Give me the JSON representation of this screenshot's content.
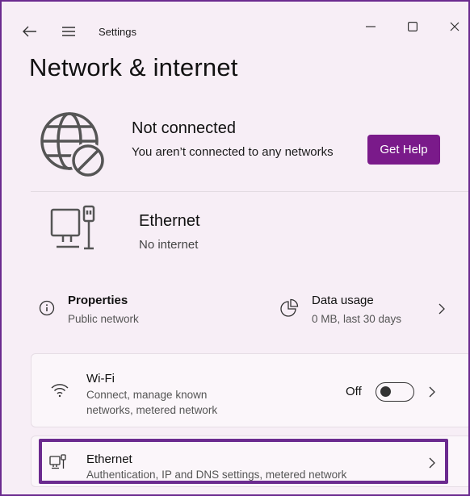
{
  "window": {
    "title": "Settings",
    "back_icon": "back-arrow-icon",
    "menu_icon": "hamburger-menu-icon",
    "controls": [
      "minimize-icon",
      "maximize-icon",
      "close-icon"
    ]
  },
  "page": {
    "title": "Network & internet"
  },
  "status": {
    "icon": "globe-blocked-icon",
    "title": "Not connected",
    "subtitle": "You aren’t connected to any networks",
    "help_button": "Get Help",
    "accent_color": "#7a1a8a"
  },
  "ethernet_summary": {
    "icon": "ethernet-computer-icon",
    "title": "Ethernet",
    "subtitle": "No internet"
  },
  "properties": {
    "icon": "info-icon",
    "label": "Properties",
    "value": "Public network"
  },
  "data_usage": {
    "icon": "pie-chart-icon",
    "label": "Data usage",
    "value": "0 MB, last 30 days"
  },
  "wifi_card": {
    "icon": "wifi-icon",
    "title": "Wi-Fi",
    "subtitle_line1": "Connect, manage known",
    "subtitle_line2": "networks, metered network",
    "toggle_label": "Off",
    "toggle_on": false
  },
  "ethernet_card": {
    "icon": "ethernet-icon",
    "title": "Ethernet",
    "subtitle": "Authentication, IP and DNS settings, metered network",
    "highlight_color": "#6b2a8f"
  }
}
